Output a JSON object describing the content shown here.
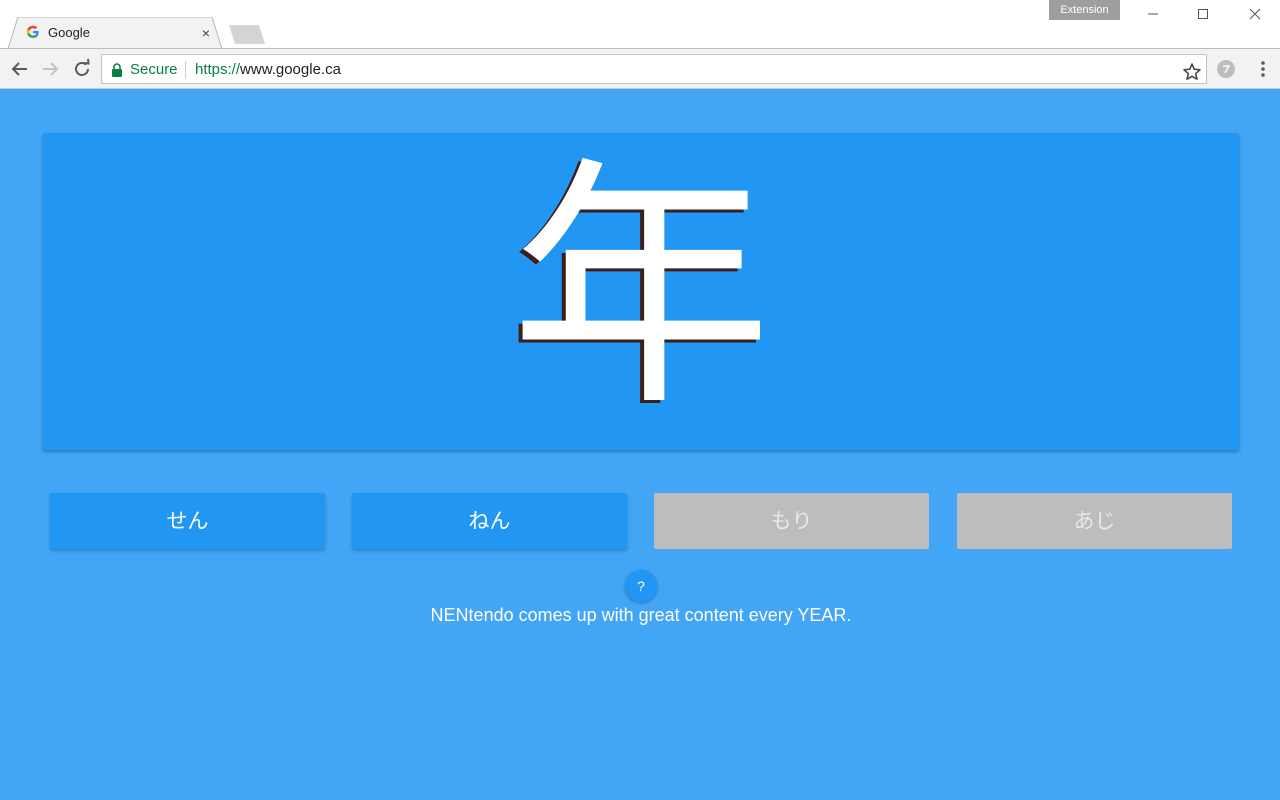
{
  "browser": {
    "tab": {
      "title": "Google",
      "close_glyph": "×",
      "favicon": "google-g-icon"
    },
    "extension_badge": "Extension",
    "omnibox": {
      "secure_label": "Secure",
      "url_scheme": "https://",
      "url_rest": "www.google.ca"
    }
  },
  "quiz": {
    "kanji": "年",
    "answers": [
      {
        "label": "せん",
        "state": "active"
      },
      {
        "label": "ねん",
        "state": "active"
      },
      {
        "label": "もり",
        "state": "disabled"
      },
      {
        "label": "あじ",
        "state": "disabled"
      }
    ],
    "help_label": "?",
    "hint": "NENtendo comes up with great content every YEAR."
  },
  "colors": {
    "page_background": "#42a5f5",
    "card_background": "#2196f3",
    "button_active": "#2196f3",
    "button_disabled": "#bdbdbd",
    "secure_green": "#0b8043"
  }
}
